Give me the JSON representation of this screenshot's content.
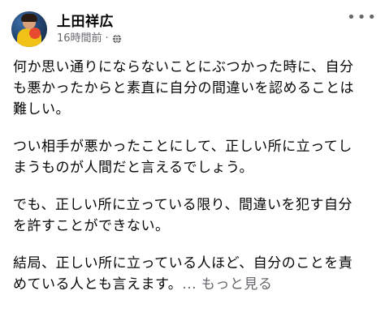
{
  "post": {
    "author": "上田祥広",
    "time": "16時間前",
    "separator": "·",
    "privacy_icon": "globe-icon",
    "more_icon": "ellipsis-icon",
    "paragraphs": [
      "何か思い通りにならないことにぶつかった時に、自分\nも悪かったからと素直に自分の間違いを認めることは\n難しい。",
      "つい相手が悪かったことにして、正しい所に立ってし\nまうものが人間だと言えるでしょう。",
      "でも、正しい所に立っている限り、間違いを犯す自分\nを許すことができない。",
      "結局、正しい所に立っている人ほど、自分のことを責\nめている人とも言えます。"
    ],
    "see_more": "... もっと見る"
  },
  "colors": {
    "text": "#050505",
    "secondary": "#65676b",
    "background": "#ffffff"
  }
}
